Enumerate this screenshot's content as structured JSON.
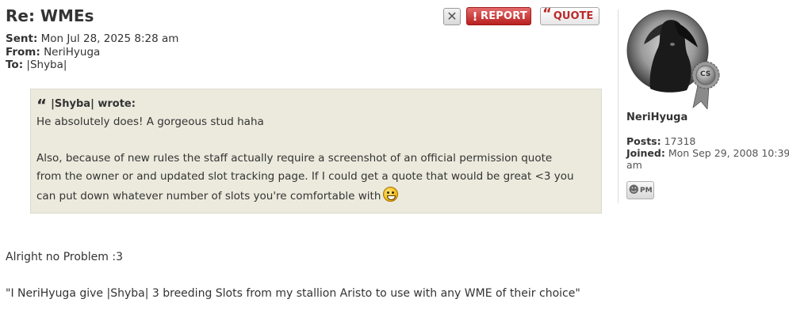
{
  "post": {
    "title": "Re: WMEs",
    "meta": {
      "sent_label": "Sent:",
      "sent_value": "Mon Jul 28, 2025 8:28 am",
      "from_label": "From:",
      "from_value": "NeriHyuga",
      "to_label": "To:",
      "to_value": "|Shyba|"
    },
    "actions": {
      "delete_icon": "close-icon",
      "report_label": "REPORT",
      "report_icon": "!",
      "quote_label": "QUOTE",
      "quote_icon": "“"
    },
    "quote": {
      "mark": "“",
      "cite": "|Shyba| wrote:",
      "line1": "He absolutely does! A gorgeous stud haha",
      "line2": "Also, because of new rules the staff actually require a screenshot of an official permission quote",
      "line3": "from the owner or and updated slot tracking page. If I could get a quote that would be great <3 you",
      "line4": "can put down whatever number of slots you're comfortable with",
      "emoji": "grin-smiley-icon"
    },
    "body": {
      "line1": "Alright no Problem :3",
      "line2": "\"I NeriHyuga give |Shyba| 3 breeding Slots from my stallion Aristo to use with any WME of their choice\""
    }
  },
  "profile": {
    "username": "NeriHyuga",
    "badge": "CS",
    "posts_label": "Posts:",
    "posts_value": "17318",
    "joined_label": "Joined:",
    "joined_value": "Mon Sep 29, 2008 10:39",
    "joined_value_cont": "am",
    "pm_label": "PM"
  },
  "colors": {
    "report_red": "#b92020",
    "quote_red": "#bb2a2a",
    "quote_bg": "#ebeadd",
    "text": "#333333"
  }
}
